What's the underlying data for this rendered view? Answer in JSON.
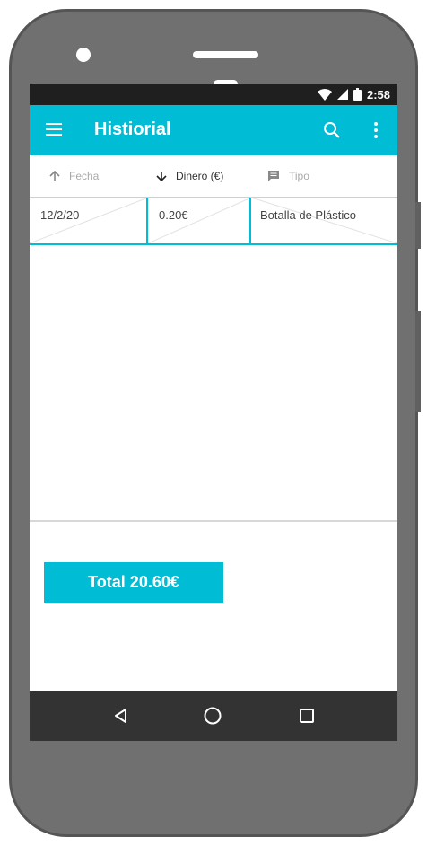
{
  "status_bar": {
    "time": "2:58",
    "icons": [
      "wifi-icon",
      "signal-icon",
      "battery-icon"
    ]
  },
  "app_bar": {
    "title": "Histiorial",
    "icons": [
      "menu-icon",
      "search-icon",
      "more-vert-icon"
    ]
  },
  "table": {
    "columns": [
      {
        "label": "Fecha",
        "sort_icon": "arrow-up-icon",
        "active": false
      },
      {
        "label": "Dinero (€)",
        "sort_icon": "arrow-down-icon",
        "active": true
      },
      {
        "label": "Tipo",
        "sort_icon": "comment-icon",
        "active": false
      }
    ],
    "rows": [
      {
        "fecha": "12/2/20",
        "dinero": "0.20€",
        "tipo": "Botalla de Plástico"
      }
    ]
  },
  "total": {
    "label": "Total 20.60€"
  },
  "colors": {
    "accent": "#00bcd4",
    "status_bar": "#1f1f1f",
    "nav_bar": "#333333",
    "phone_body": "#707070"
  },
  "nav": [
    "back-icon",
    "home-icon",
    "recents-icon"
  ]
}
